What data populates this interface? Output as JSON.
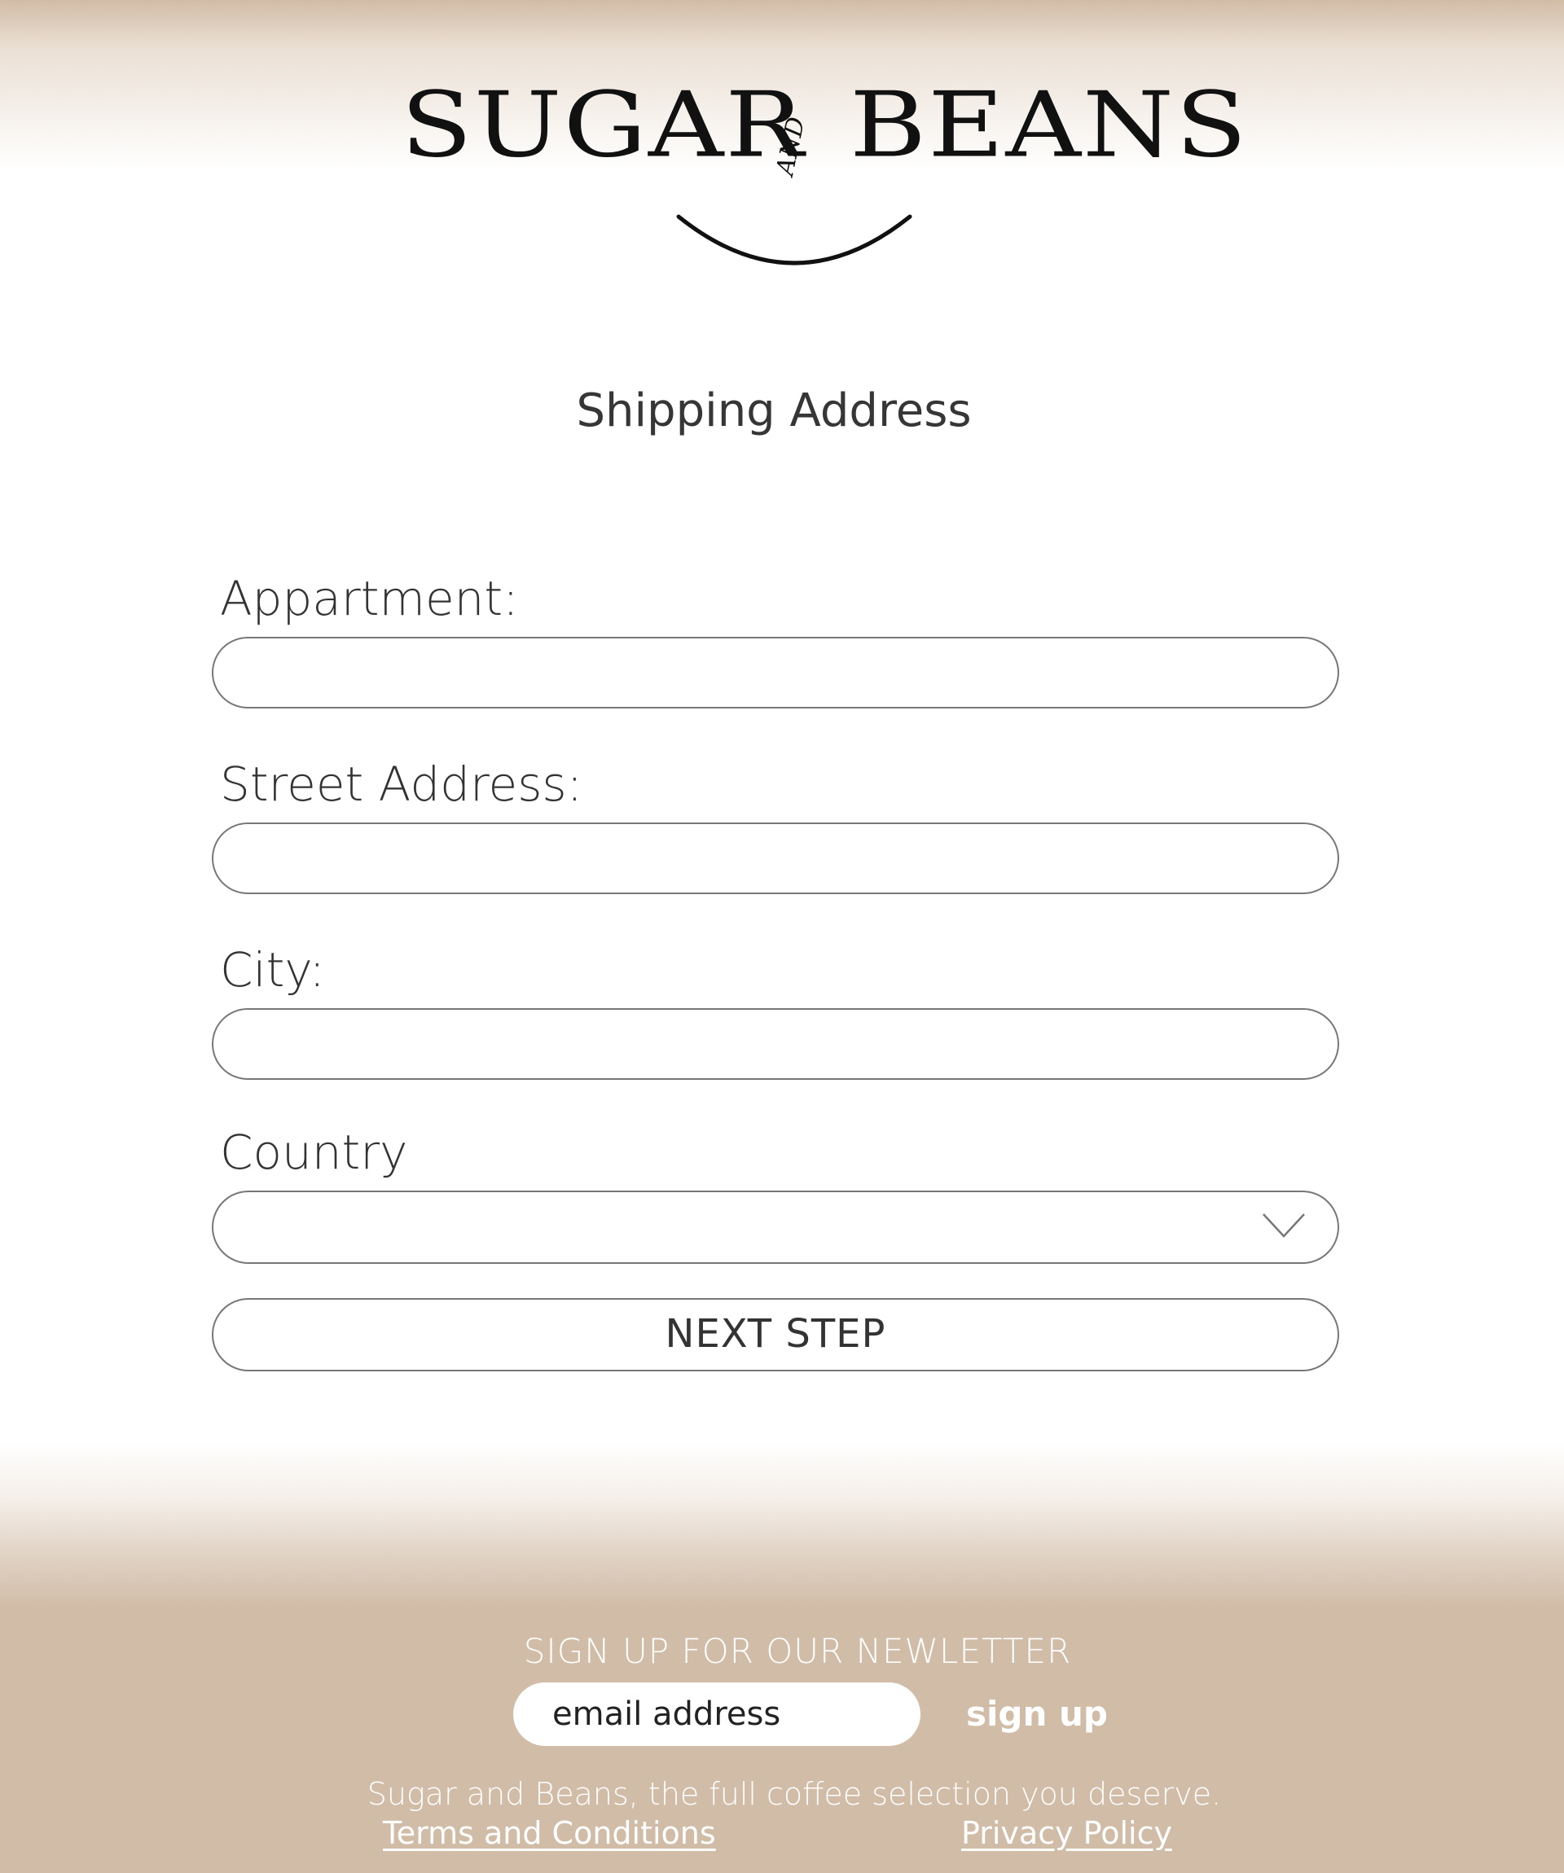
{
  "brand": {
    "word1": "SUGAR",
    "and": "AND",
    "word2": "BEANS"
  },
  "page": {
    "title": "Shipping Address"
  },
  "form": {
    "fields": [
      {
        "label": "Appartment:",
        "value": "",
        "placeholder": ""
      },
      {
        "label": "Street Address:",
        "value": "",
        "placeholder": ""
      },
      {
        "label": "City:",
        "value": "",
        "placeholder": ""
      }
    ],
    "country": {
      "label": "Country",
      "selected": ""
    },
    "next_label": "NEXT STEP"
  },
  "footer": {
    "newsletter_heading": "SIGN UP FOR OUR NEWLETTER",
    "email_placeholder": "email address",
    "signup_label": "sign up",
    "tagline": "Sugar and Beans, the full coffee selection you deserve.",
    "terms_label": "Terms and Conditions",
    "privacy_label": "Privacy Policy"
  },
  "colors": {
    "beige": "#d1bca7",
    "text": "#333333",
    "border": "#777777"
  },
  "icons": {
    "country_dropdown": "chevron-down-icon"
  }
}
